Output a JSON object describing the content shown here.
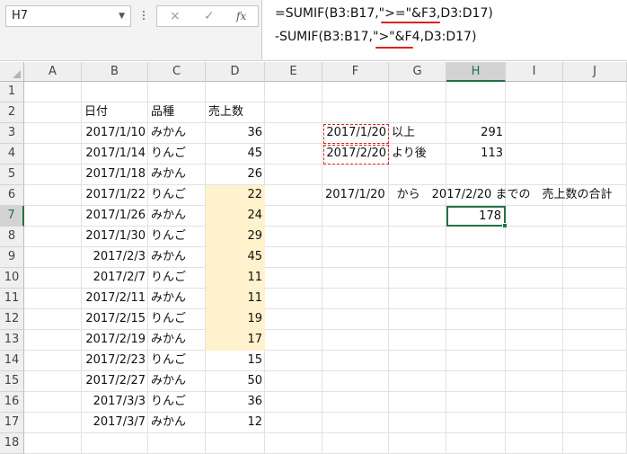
{
  "name_box": "H7",
  "formula_bar": {
    "line1": "=SUMIF(B3:B17,\">=\"&F3,D3:D17)",
    "line2": "-SUMIF(B3:B17,\">\"&F4,D3:D17)",
    "cancel_icon": "×",
    "enter_icon": "✓",
    "fx_label": "fx"
  },
  "columns": [
    "A",
    "B",
    "C",
    "D",
    "E",
    "F",
    "G",
    "H",
    "I",
    "J"
  ],
  "rows": [
    "1",
    "2",
    "3",
    "4",
    "5",
    "6",
    "7",
    "8",
    "9",
    "10",
    "11",
    "12",
    "13",
    "14",
    "15",
    "16",
    "17",
    "18"
  ],
  "headers": {
    "date": "日付",
    "variety": "品種",
    "sales": "売上数"
  },
  "table": [
    {
      "date": "2017/1/10",
      "variety": "みかん",
      "qty": "36"
    },
    {
      "date": "2017/1/14",
      "variety": "りんご",
      "qty": "45"
    },
    {
      "date": "2017/1/18",
      "variety": "みかん",
      "qty": "26"
    },
    {
      "date": "2017/1/22",
      "variety": "りんご",
      "qty": "22"
    },
    {
      "date": "2017/1/26",
      "variety": "みかん",
      "qty": "24"
    },
    {
      "date": "2017/1/30",
      "variety": "りんご",
      "qty": "29"
    },
    {
      "date": "2017/2/3",
      "variety": "みかん",
      "qty": "45"
    },
    {
      "date": "2017/2/7",
      "variety": "りんご",
      "qty": "11"
    },
    {
      "date": "2017/2/11",
      "variety": "みかん",
      "qty": "11"
    },
    {
      "date": "2017/2/15",
      "variety": "りんご",
      "qty": "19"
    },
    {
      "date": "2017/2/19",
      "variety": "みかん",
      "qty": "17"
    },
    {
      "date": "2017/2/23",
      "variety": "りんご",
      "qty": "15"
    },
    {
      "date": "2017/2/27",
      "variety": "みかん",
      "qty": "50"
    },
    {
      "date": "2017/3/3",
      "variety": "りんご",
      "qty": "36"
    },
    {
      "date": "2017/3/7",
      "variety": "みかん",
      "qty": "12"
    }
  ],
  "criteria": [
    {
      "date": "2017/1/20",
      "label": "以上",
      "value": "291"
    },
    {
      "date": "2017/2/20",
      "label": "より後",
      "value": "113"
    }
  ],
  "summary_label": "2017/1/20　から　2017/2/20 までの　売上数の合計",
  "result": "178",
  "colors": {
    "accent": "#217346",
    "highlight": "#fff2cc",
    "annotation": "#e02020"
  }
}
